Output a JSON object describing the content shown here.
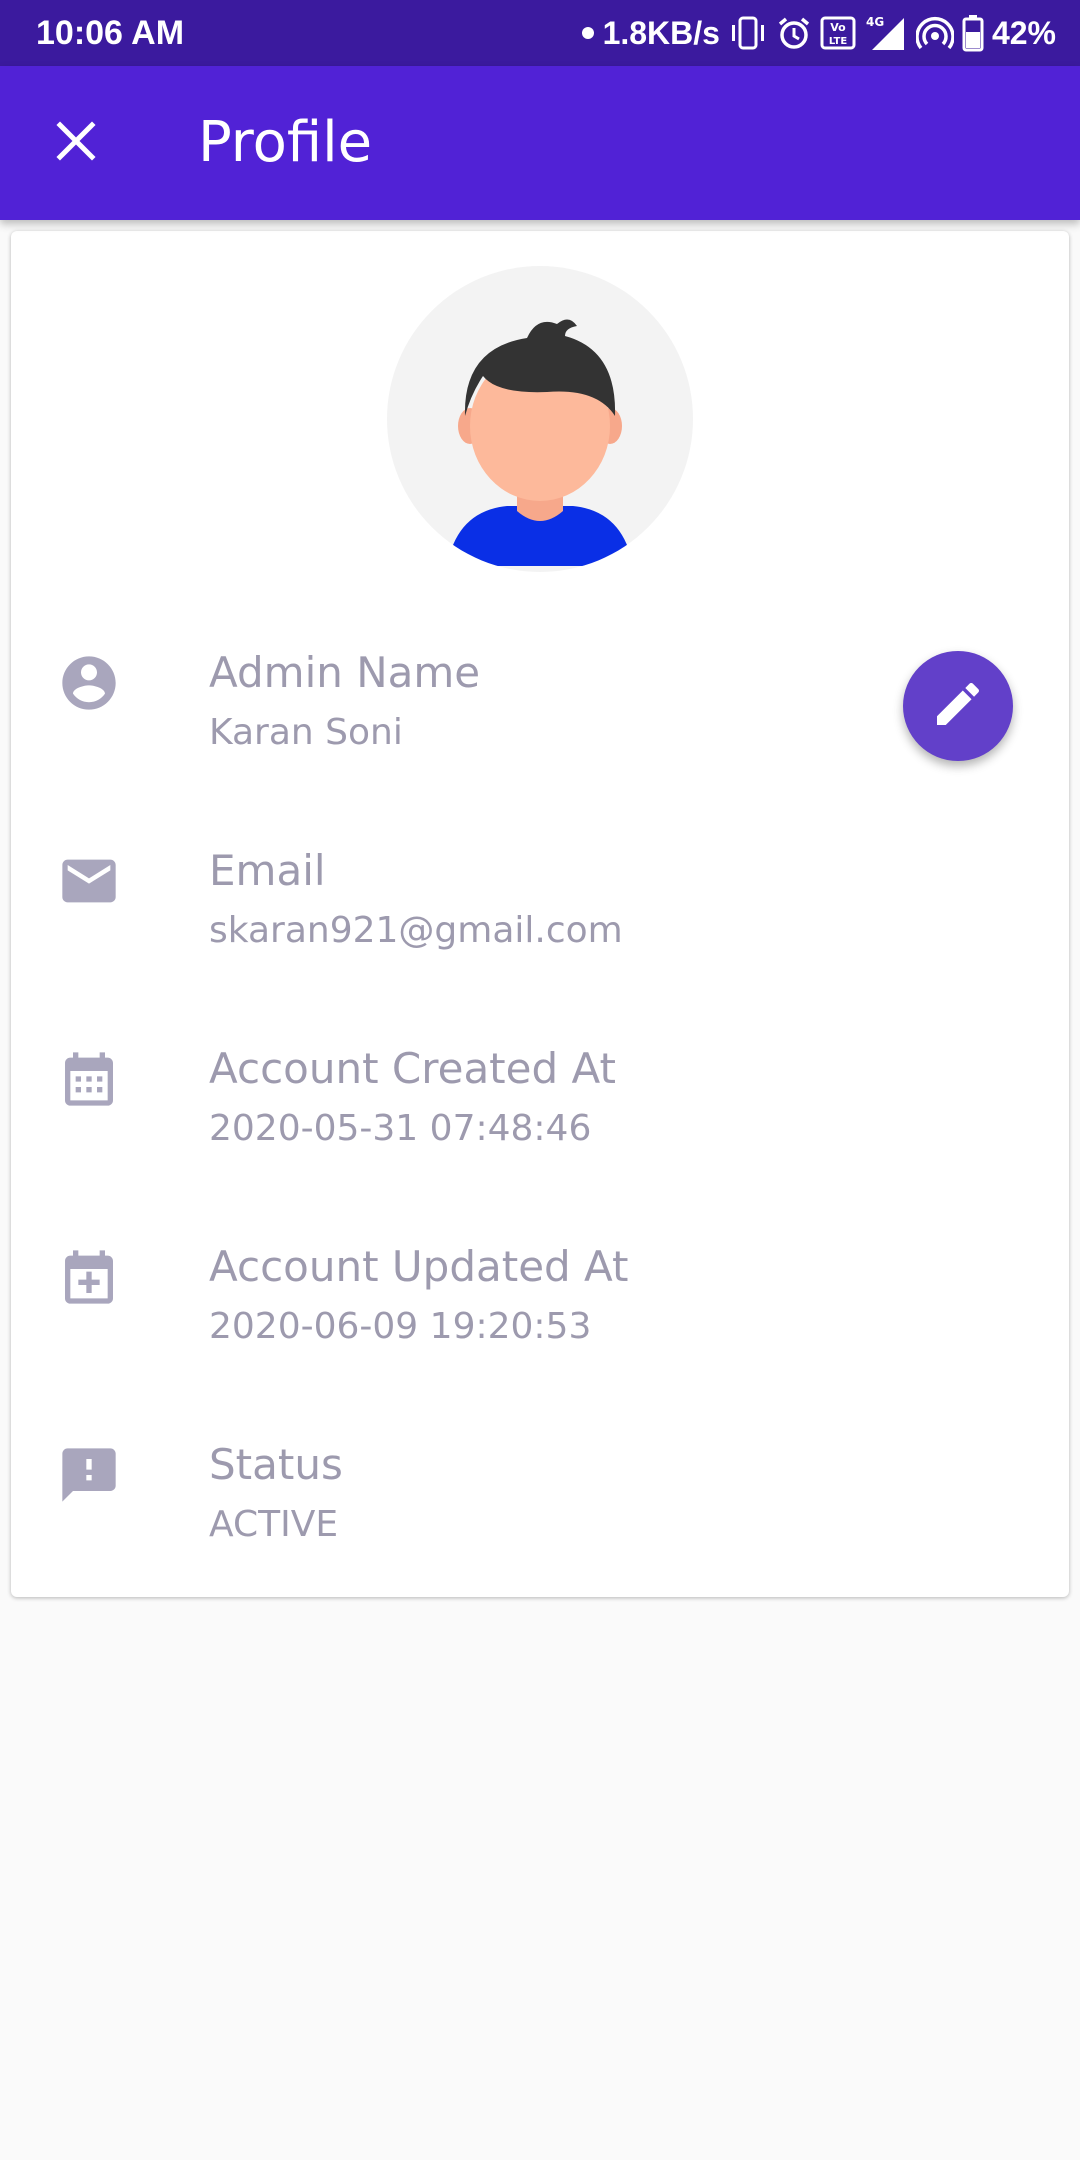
{
  "status_bar": {
    "time": "10:06 AM",
    "network_speed": "1.8KB/s",
    "battery": "42%",
    "icons": [
      "dot-icon",
      "vibrate-icon",
      "alarm-icon",
      "volte-icon",
      "signal-4g-icon",
      "hotspot-icon",
      "battery-icon"
    ]
  },
  "app_bar": {
    "title": "Profile",
    "close_icon": "close-icon"
  },
  "profile": {
    "avatar": "avatar-illustration",
    "fields": [
      {
        "label": "Admin Name",
        "value": "Karan Soni",
        "icon": "account-circle-icon"
      },
      {
        "label": "Email",
        "value": "skaran921@gmail.com",
        "icon": "email-icon"
      },
      {
        "label": "Account Created At",
        "value": "2020-05-31 07:48:46",
        "icon": "calendar-icon"
      },
      {
        "label": "Account Updated At",
        "value": "2020-06-09 19:20:53",
        "icon": "calendar-plus-icon"
      },
      {
        "label": "Status",
        "value": "ACTIVE",
        "icon": "feedback-icon"
      }
    ]
  },
  "fab": {
    "icon": "edit-icon"
  },
  "colors": {
    "status_bar": "#3b1a9e",
    "app_bar": "#5122d6",
    "fab": "#6240c9",
    "text_muted": "#9d9aae",
    "icon": "#a9a6bd"
  }
}
